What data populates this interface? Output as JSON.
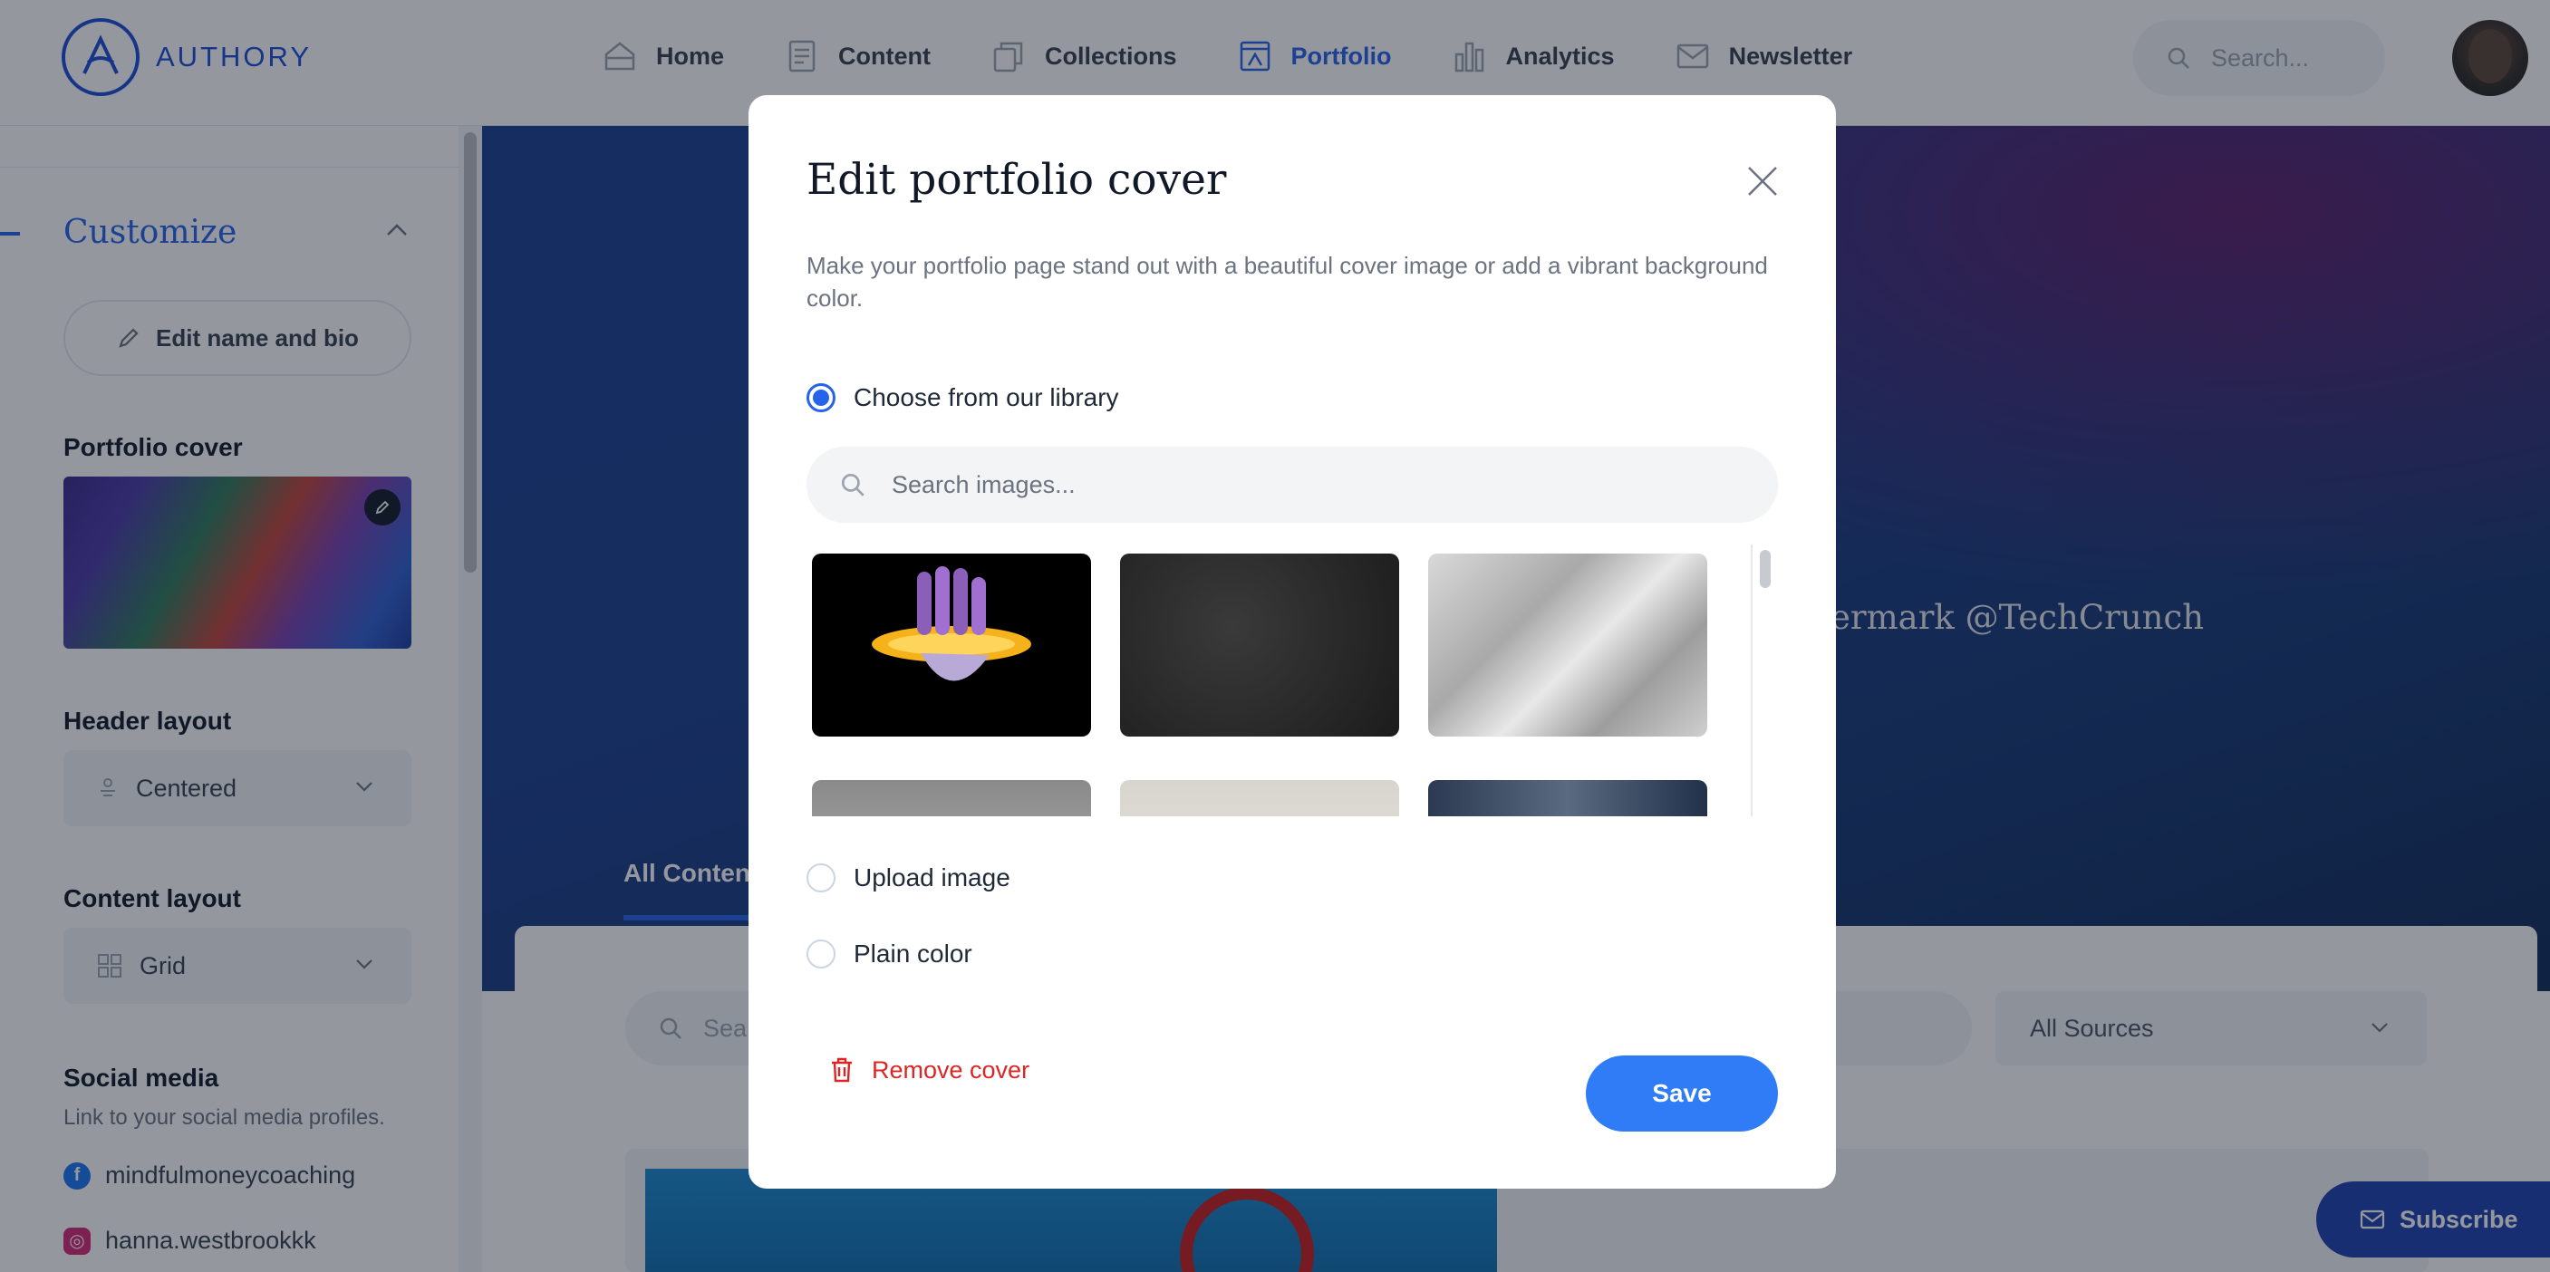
{
  "brand": {
    "name": "AUTHORY"
  },
  "nav": {
    "items": [
      {
        "label": "Home",
        "icon": "home-icon"
      },
      {
        "label": "Content",
        "icon": "document-icon"
      },
      {
        "label": "Collections",
        "icon": "collections-icon"
      },
      {
        "label": "Portfolio",
        "icon": "portfolio-icon",
        "active": true
      },
      {
        "label": "Analytics",
        "icon": "bar-chart-icon"
      },
      {
        "label": "Newsletter",
        "icon": "mail-icon"
      }
    ],
    "search_placeholder": "Search..."
  },
  "sidebar": {
    "section_title": "Customize",
    "edit_bio_label": "Edit name and bio",
    "portfolio_cover_label": "Portfolio cover",
    "header_layout": {
      "label": "Header layout",
      "value": "Centered"
    },
    "content_layout": {
      "label": "Content layout",
      "value": "Grid"
    },
    "social": {
      "title": "Social media",
      "subtitle": "Link to your social media profiles.",
      "profiles": [
        {
          "network": "facebook",
          "handle": "mindfulmoneycoaching"
        },
        {
          "network": "instagram",
          "handle": "hanna.westbrookkk"
        }
      ]
    }
  },
  "main": {
    "hero_tagline": "ermark @TechCrunch",
    "tab_label": "All Conten",
    "search_placeholder": "Sea",
    "sources_select": "All Sources",
    "subscribe_label": "Subscribe"
  },
  "modal": {
    "title": "Edit portfolio cover",
    "description": "Make your portfolio page stand out with a beautiful cover image or add a vibrant background color.",
    "options": {
      "library": "Choose from our library",
      "upload": "Upload image",
      "plain": "Plain color"
    },
    "selected_option": "library",
    "image_search_placeholder": "Search images...",
    "remove_label": "Remove cover",
    "save_label": "Save"
  },
  "colors": {
    "accent": "#2563eb",
    "save_button": "#2f7cf6",
    "danger": "#dc2626",
    "hero_bg": "#1a3e8e"
  }
}
